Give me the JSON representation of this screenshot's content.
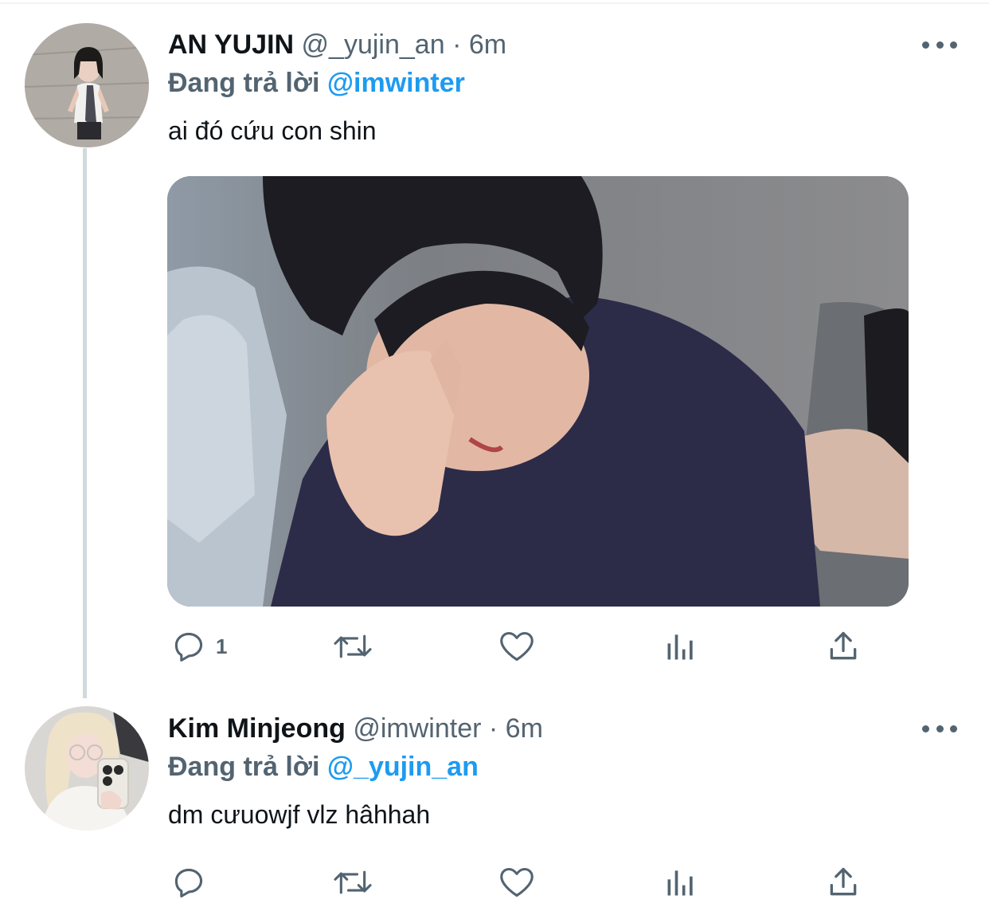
{
  "tweets": [
    {
      "name": "AN YUJIN",
      "handle": "@_yujin_an",
      "separator": "·",
      "time": "6m",
      "replying_prefix": "Đang trả lời",
      "replying_to": "@imwinter",
      "text": "ai đó cứu con shin",
      "reply_count": "1"
    },
    {
      "name": "Kim Minjeong",
      "handle": "@imwinter",
      "separator": "·",
      "time": "6m",
      "replying_prefix": "Đang trả lời",
      "replying_to": "@_yujin_an",
      "text": "dm cưuowjf vlz hâhhah",
      "reply_count": ""
    }
  ],
  "icons": {
    "reply": "reply-icon",
    "retweet": "retweet-icon",
    "like": "heart-icon",
    "analytics": "analytics-icon",
    "share": "share-icon",
    "more": "more-icon"
  },
  "colors": {
    "mention": "#1d9bf0",
    "secondary_text": "#536471",
    "thread_line": "#cfd9de"
  }
}
